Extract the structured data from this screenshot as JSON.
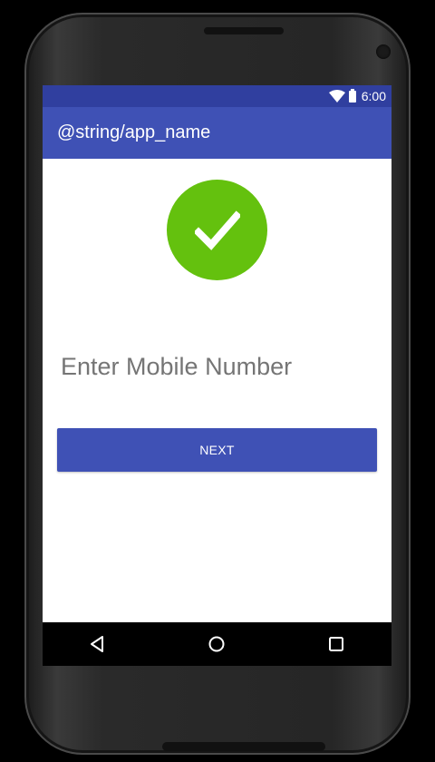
{
  "statusbar": {
    "time": "6:00",
    "icons": [
      "wifi-icon",
      "battery-icon"
    ]
  },
  "toolbar": {
    "title": "@string/app_name"
  },
  "main": {
    "check_icon": "check-circle-icon",
    "mobile_input": {
      "value": "",
      "placeholder": "Enter Mobile Number"
    },
    "next_label": "NEXT"
  },
  "navbar": {
    "buttons": [
      "back-icon",
      "home-icon",
      "recents-icon"
    ]
  },
  "colors": {
    "status_bar": "#303f9f",
    "primary": "#3f51b5",
    "success": "#64c10e",
    "background": "#ffffff"
  }
}
